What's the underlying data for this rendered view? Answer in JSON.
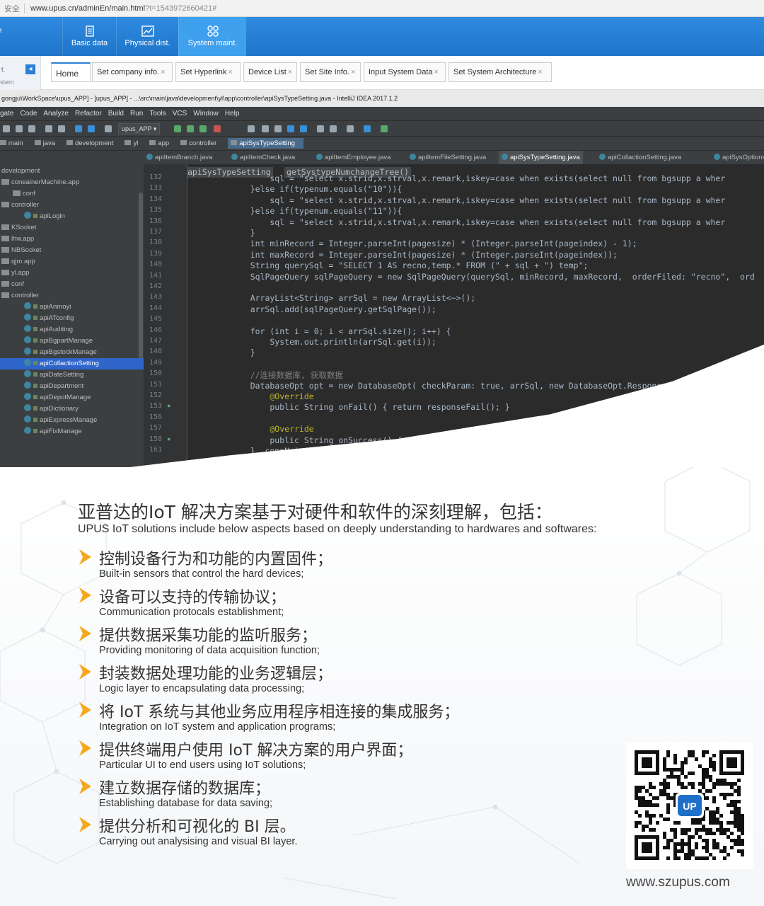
{
  "browser": {
    "security_label": "安全",
    "url_main": "www.upus.cn/adminEn/main.html",
    "url_query": "?t=1543972660421#"
  },
  "admin": {
    "brand_line1": "t ",
    "nav": [
      {
        "label": "Basic data",
        "icon": "document-icon"
      },
      {
        "label": "Physical dist.",
        "icon": "chart-icon"
      },
      {
        "label": "System maint.",
        "icon": "grid-icon"
      }
    ],
    "sidebar_label": "t.",
    "sidebar_sub": "stem",
    "tabs": [
      {
        "label": "Home"
      },
      {
        "label": "Set company info."
      },
      {
        "label": "Set Hyperlink"
      },
      {
        "label": "Device List"
      },
      {
        "label": "Set Site Info."
      },
      {
        "label": "Input System Data"
      },
      {
        "label": "Set System Architecture"
      }
    ],
    "close_glyph": "×"
  },
  "ide": {
    "title": "gongju\\WorkSpace\\upus_APP] - [upus_APP] - ...\\src\\main\\java\\development\\yl\\app\\controller\\apiSysTypeSetting.java - IntelliJ IDEA 2017.1.2",
    "menu": [
      "gate",
      "Code",
      "Analyze",
      "Refactor",
      "Build",
      "Run",
      "Tools",
      "VCS",
      "Window",
      "Help"
    ],
    "run_config": "upus_APP ▾",
    "breadcrumb": [
      "main",
      "java",
      "development",
      "yl",
      "app",
      "controller",
      "apiSysTypeSetting"
    ],
    "file_tabs": [
      "apiItemBranch.java",
      "apiItemCheck.java",
      "apiItemEmployee.java",
      "apiItemFileSetting.java",
      "apiSysTypeSetting.java",
      "apiCollactionSetting.java",
      "apiSysOptions"
    ],
    "code_crumb": [
      "apiSysTypeSetting",
      "getSystypeNumchangeTree()"
    ],
    "tree": [
      {
        "label": "development",
        "kind": "text"
      },
      {
        "label": "coneainerMachine.app",
        "kind": "folder"
      },
      {
        "label": "conf",
        "kind": "folder"
      },
      {
        "label": "controller",
        "kind": "folder"
      },
      {
        "label": "apiLogin",
        "kind": "class"
      },
      {
        "label": "KSocket",
        "kind": "folder"
      },
      {
        "label": "lhw.app",
        "kind": "folder"
      },
      {
        "label": "NBSocket",
        "kind": "folder"
      },
      {
        "label": "qjm.app",
        "kind": "folder"
      },
      {
        "label": "yl.app",
        "kind": "folder"
      },
      {
        "label": "conf",
        "kind": "folder"
      },
      {
        "label": "controller",
        "kind": "folder"
      },
      {
        "label": "apiAnmoyi",
        "kind": "class"
      },
      {
        "label": "apiATconfig",
        "kind": "class"
      },
      {
        "label": "apiAuditing",
        "kind": "class"
      },
      {
        "label": "apiBgpartManage",
        "kind": "class"
      },
      {
        "label": "apiBgstockManage",
        "kind": "class"
      },
      {
        "label": "apiCollactionSetting",
        "kind": "class"
      },
      {
        "label": "apiDateSetting",
        "kind": "class"
      },
      {
        "label": "apiDepartment",
        "kind": "class"
      },
      {
        "label": "apiDepotManage",
        "kind": "class"
      },
      {
        "label": "apiDictionary",
        "kind": "class"
      },
      {
        "label": "apiExpressManage",
        "kind": "class"
      },
      {
        "label": "apiFixManage",
        "kind": "class"
      }
    ],
    "line_numbers": [
      "132",
      "133",
      "134",
      "135",
      "136",
      "137",
      "138",
      "139",
      "140",
      "141",
      "142",
      "143",
      "144",
      "145",
      "146",
      "147",
      "148",
      "149",
      "150",
      "151",
      "152",
      "153",
      "156",
      "157",
      "158",
      "161"
    ],
    "code": [
      "        sql = \"select x.strid,x.strval,x.remark,iskey=case when exists(select null from bgsupp a wher",
      "    }else if(typenum.equals(\"10\")){",
      "        sql = \"select x.strid,x.strval,x.remark,iskey=case when exists(select null from bgsupp a wher",
      "    }else if(typenum.equals(\"11\")){",
      "        sql = \"select x.strid,x.strval,x.remark,iskey=case when exists(select null from bgsupp a wher",
      "    }",
      "    int minRecord = Integer.parseInt(pagesize) * (Integer.parseInt(pageindex) - 1);",
      "    int maxRecord = Integer.parseInt(pagesize) * (Integer.parseInt(pageindex));",
      "    String querySql = \"SELECT 1 AS recno,temp.* FROM (\" + sql + \") temp\";",
      "    SqlPageQuery sqlPageQuery = new SqlPageQuery(querySql, minRecord, maxRecord,  orderFiled: \"recno\",  ord",
      "",
      "    ArrayList<String> arrSql = new ArrayList<~>();",
      "    arrSql.add(sqlPageQuery.getSqlPage());",
      "",
      "    for (int i = 0; i < arrSql.size(); i++) {",
      "        System.out.println(arrSql.get(i));",
      "    }",
      "",
      "    //连接数据库, 获取数据",
      "    DatabaseOpt opt = new DatabaseOpt( checkParam: true, arrSql, new DatabaseOpt.ResponseInfo() {",
      "        @Override",
      "        public String onFail() { return responseFail(); }",
      "",
      "        @Override",
      "        public String onSuccess() { return responseSuccess(); }",
      "    }, compNo);"
    ]
  },
  "intro": {
    "title_cn": "亚普达的IoT 解决方案基于对硬件和软件的深刻理解，包括：",
    "title_en": "UPUS IoT solutions include below aspects based on deeply understanding to hardwares and softwares:"
  },
  "items": [
    {
      "cn": "控制设备行为和功能的内置固件；",
      "en": "Built-in sensors that control the hard devices;"
    },
    {
      "cn": "设备可以支持的传输协议；",
      "en": "Communication protocals establishment;"
    },
    {
      "cn": "提供数据采集功能的监听服务；",
      "en": "Providing monitoring of data acquisition function;"
    },
    {
      "cn": "封装数据处理功能的业务逻辑层；",
      "en": "Logic layer to encapsulating data processing;"
    },
    {
      "cn": "将 IoT 系统与其他业务应用程序相连接的集成服务；",
      "en": "Integration on IoT system and application programs;"
    },
    {
      "cn": "提供终端用户使用 IoT 解决方案的用户界面；",
      "en": "Particular UI to end users using IoT solutions;"
    },
    {
      "cn": "建立数据存储的数据库；",
      "en": "Establishing database for data saving;"
    },
    {
      "cn": "提供分析和可视化的 BI 层。",
      "en": "Carrying out analysising and visual BI layer."
    }
  ],
  "qr": {
    "logo_text": "UP"
  },
  "website": "www.szupus.com",
  "colors": {
    "accent": "#2b7fd4",
    "arrow": "#f5a81c",
    "ide_bg": "#2b2b2b"
  }
}
